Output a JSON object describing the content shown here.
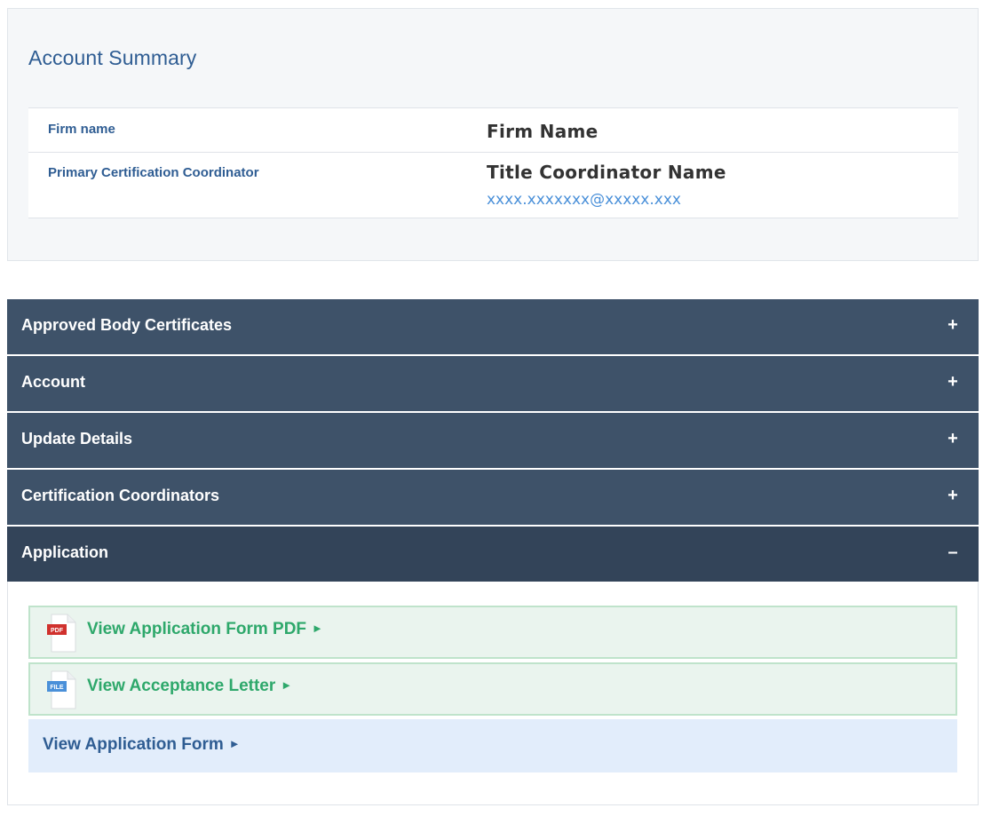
{
  "summary": {
    "title": "Account Summary",
    "rows": [
      {
        "label": "Firm name",
        "value": "Firm Name"
      },
      {
        "label": "Primary Certification Coordinator",
        "value": "Title Coordinator Name",
        "email": "xxxx.xxxxxxx@xxxxx.xxx"
      }
    ]
  },
  "accordion": {
    "sections": [
      {
        "title": "Approved Body Certificates",
        "toggle": "+"
      },
      {
        "title": "Account",
        "toggle": "+"
      },
      {
        "title": "Update Details",
        "toggle": "+"
      },
      {
        "title": "Certification Coordinators",
        "toggle": "+"
      },
      {
        "title": "Application",
        "toggle": "–"
      }
    ],
    "application_links": [
      {
        "label": "View Application Form PDF",
        "arrow": "►",
        "icon": "pdf-file-icon",
        "badge": "PDF"
      },
      {
        "label": "View Acceptance Letter",
        "arrow": "►",
        "icon": "generic-file-icon",
        "badge": "FILE"
      },
      {
        "label": "View Application Form",
        "arrow": "►"
      }
    ]
  },
  "colors": {
    "accent_blue": "#2f5d93",
    "header_bg": "#3e5269",
    "link_green": "#2ea86b",
    "email_blue": "#4a90d9"
  }
}
